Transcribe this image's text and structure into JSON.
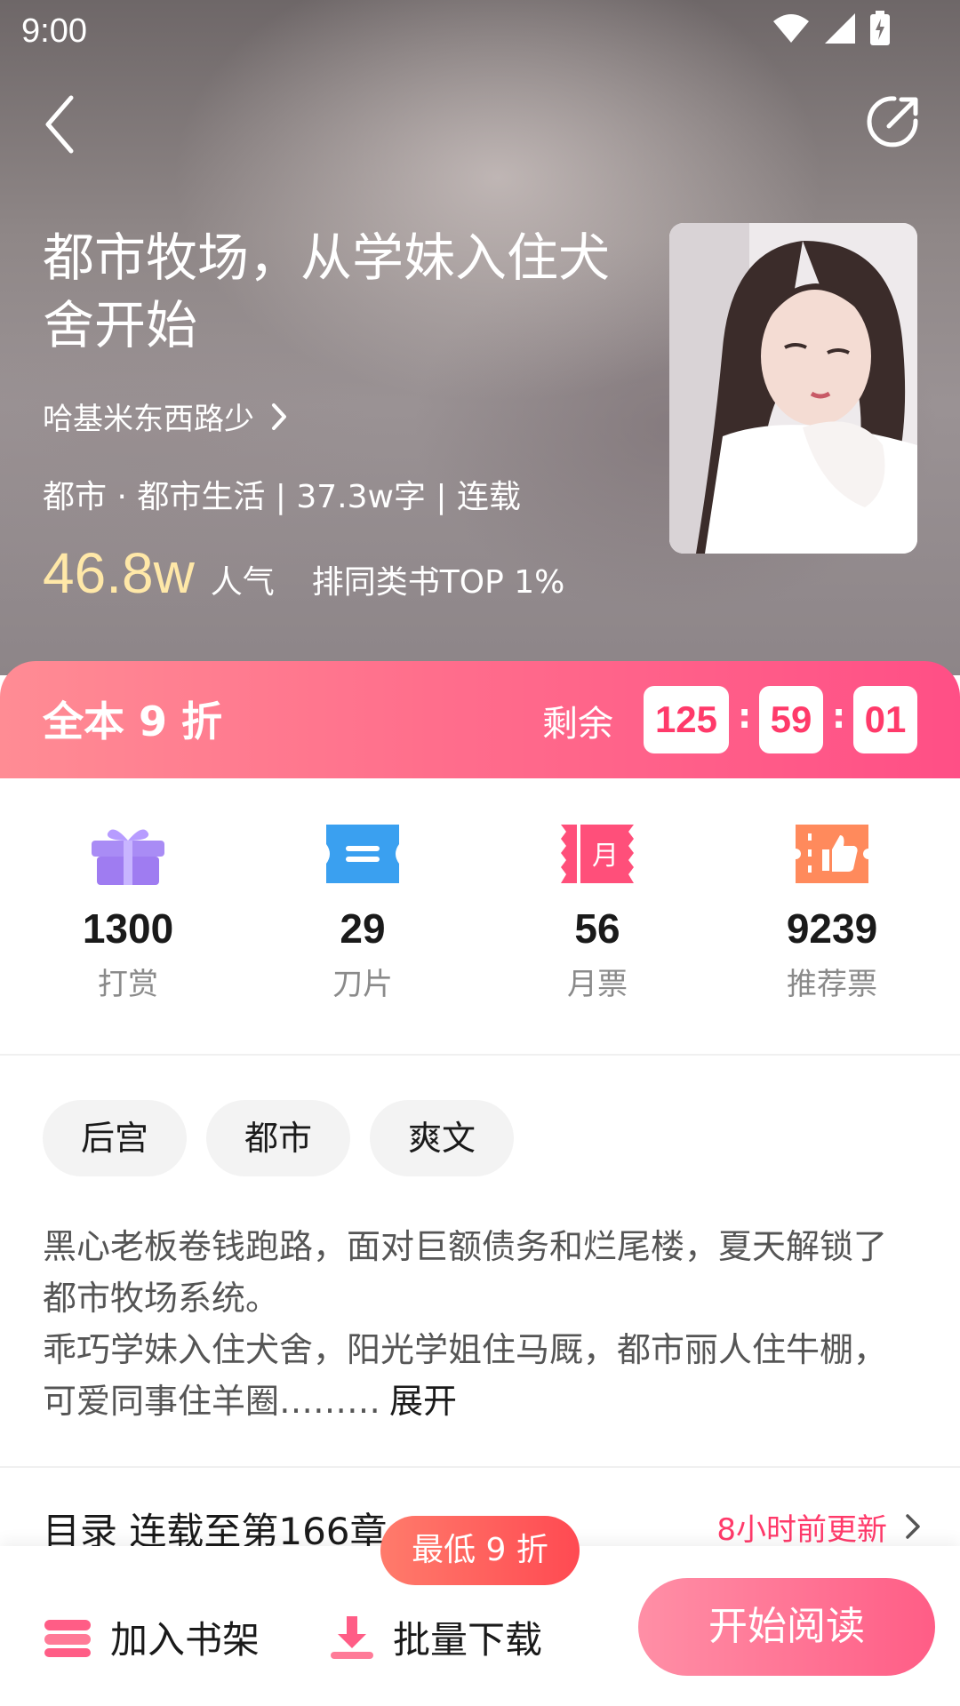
{
  "status_bar": {
    "time": "9:00"
  },
  "book": {
    "title": "都市牧场，从学妹入住犬舍开始",
    "author": "哈基米东西路少",
    "meta": "都市 · 都市生活 | 37.3w字 | 连载",
    "popularity_value": "46.8w",
    "popularity_label": "人气",
    "rank_text": "排同类书TOP 1%"
  },
  "promo": {
    "title": "全本 9 折",
    "remain_label": "剩余",
    "timer": {
      "hours": "125",
      "minutes": "59",
      "seconds": "01"
    },
    "colon": ":"
  },
  "stats": [
    {
      "value": "1300",
      "label": "打赏",
      "icon": "gift-icon",
      "color": "#9f7cf1"
    },
    {
      "value": "29",
      "label": "刀片",
      "icon": "blade-ticket-icon",
      "color": "#3aa0f0"
    },
    {
      "value": "56",
      "label": "月票",
      "icon": "monthly-ticket-icon",
      "color": "#ff4f7a"
    },
    {
      "value": "9239",
      "label": "推荐票",
      "icon": "thumbs-up-ticket-icon",
      "color": "#ff8a5c"
    }
  ],
  "tags": [
    "后宫",
    "都市",
    "爽文"
  ],
  "description": {
    "line1": "黑心老板卷钱跑路，面对巨额债务和烂尾楼，夏天解锁了都市牧场系统。",
    "line2": "乖巧学妹入住犬舍，阳光学姐住马厩，都市丽人住牛棚，可爱同事住羊圈………",
    "expand": "展开"
  },
  "toc": {
    "title": "目录 连载至第166章",
    "update": "8小时前更新"
  },
  "bottom_bar": {
    "shelf_label": "加入书架",
    "download_label": "批量下载",
    "read_label": "开始阅读",
    "discount_bubble": "最低 9 折"
  },
  "colors": {
    "accent": "#ff4f86",
    "timer_text": "#ff3a6a",
    "popularity": "#ffe8a8"
  }
}
